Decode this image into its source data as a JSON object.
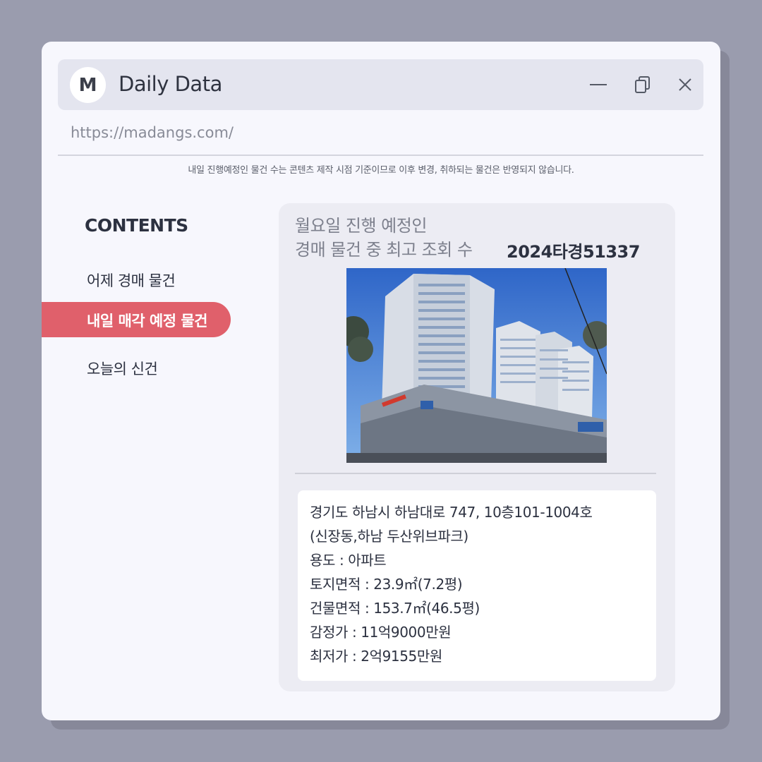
{
  "app": {
    "avatar_letter": "M",
    "title": "Daily Data",
    "url": "https://madangs.com/"
  },
  "notice": "내일 진행예정인 물건 수는 콘텐츠 제작 시점 기준이므로 이후 변경, 취하되는 물건은 반영되지 않습니다.",
  "sidebar": {
    "title": "CONTENTS",
    "items": [
      {
        "label": "어제 경매 물건",
        "active": false
      },
      {
        "label": "내일 매각 예정 물건",
        "active": true
      },
      {
        "label": "오늘의 신건",
        "active": false
      }
    ]
  },
  "card": {
    "heading_line1": "월요일 진행 예정인",
    "heading_line2": "경매 물건 중 최고 조회 수",
    "case_number": "2024타경51337",
    "info_lines": [
      "경기도 하남시 하남대로 747, 10층101-1004호",
      "(신장동,하남 두산위브파크)",
      "용도 : 아파트",
      "토지면적 : 23.9㎡(7.2평)",
      "건물면적 : 153.7㎡(46.5평)",
      "감정가 : 11억9000만원",
      "최저가 : 2억9155만원"
    ]
  },
  "colors": {
    "accent": "#e0606b",
    "background": "#9a9cae",
    "window": "#f7f7fd"
  },
  "icons": [
    "minimize-icon",
    "restore-icon",
    "close-icon"
  ]
}
